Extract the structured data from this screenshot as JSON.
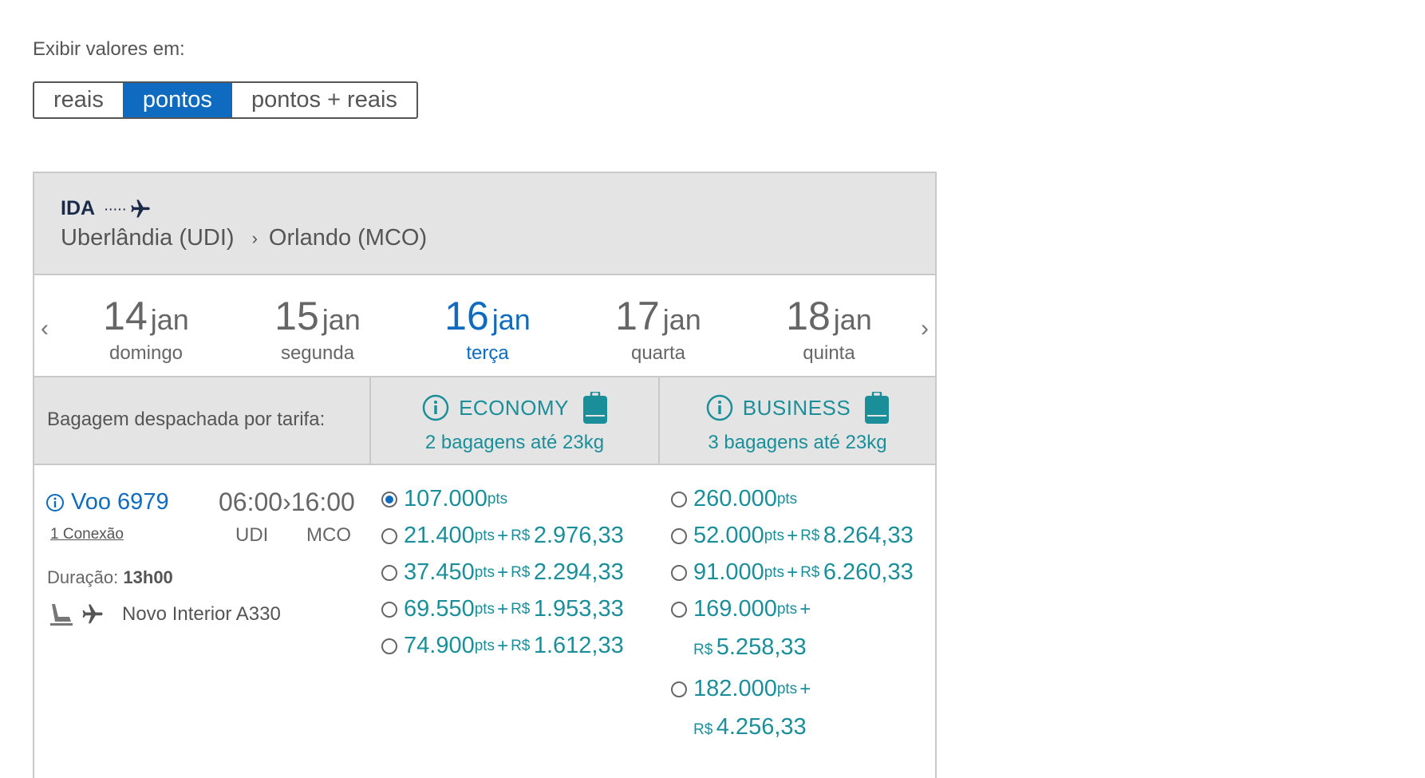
{
  "display": {
    "label": "Exibir valores em:",
    "options": [
      "reais",
      "pontos",
      "pontos + reais"
    ],
    "selected": "pontos"
  },
  "route": {
    "direction": "IDA",
    "origin": "Uberlândia (UDI)",
    "separator": "›",
    "destination": "Orlando (MCO)"
  },
  "dates": [
    {
      "day": "14",
      "month": "jan",
      "weekday": "domingo"
    },
    {
      "day": "15",
      "month": "jan",
      "weekday": "segunda"
    },
    {
      "day": "16",
      "month": "jan",
      "weekday": "terça",
      "selected": true
    },
    {
      "day": "17",
      "month": "jan",
      "weekday": "quarta"
    },
    {
      "day": "18",
      "month": "jan",
      "weekday": "quinta"
    }
  ],
  "nav": {
    "prev": "‹",
    "next": "›"
  },
  "baggage": {
    "label": "Bagagem despachada por tarifa:",
    "economy": {
      "name": "ECONOMY",
      "allowance": "2 bagagens até 23kg"
    },
    "business": {
      "name": "BUSINESS",
      "allowance": "3 bagagens até 23kg"
    }
  },
  "flight": {
    "number": "Voo 6979",
    "connection": "1 Conexão",
    "depart": "06:00",
    "arrow": "›",
    "arrive": "16:00",
    "from": "UDI",
    "to": "MCO",
    "duration_label": "Duração:",
    "duration_value": "13h00",
    "aircraft": "Novo Interior A330"
  },
  "units": {
    "pts": "pts",
    "plus": "+",
    "currency": "R$"
  },
  "economy_fares": [
    {
      "points": "107.000",
      "selected": true
    },
    {
      "points": "21.400",
      "cash": "2.976,33"
    },
    {
      "points": "37.450",
      "cash": "2.294,33"
    },
    {
      "points": "69.550",
      "cash": "1.953,33"
    },
    {
      "points": "74.900",
      "cash": "1.612,33"
    }
  ],
  "business_fares": [
    {
      "points": "260.000"
    },
    {
      "points": "52.000",
      "cash": "8.264,33"
    },
    {
      "points": "91.000",
      "cash": "6.260,33"
    },
    {
      "points": "169.000",
      "cash": "5.258,33"
    },
    {
      "points": "182.000",
      "cash": "4.256,33"
    }
  ],
  "colors": {
    "accent": "#0e6bbf",
    "teal": "#1a8f9a",
    "header_bg": "#e4e4e4"
  }
}
